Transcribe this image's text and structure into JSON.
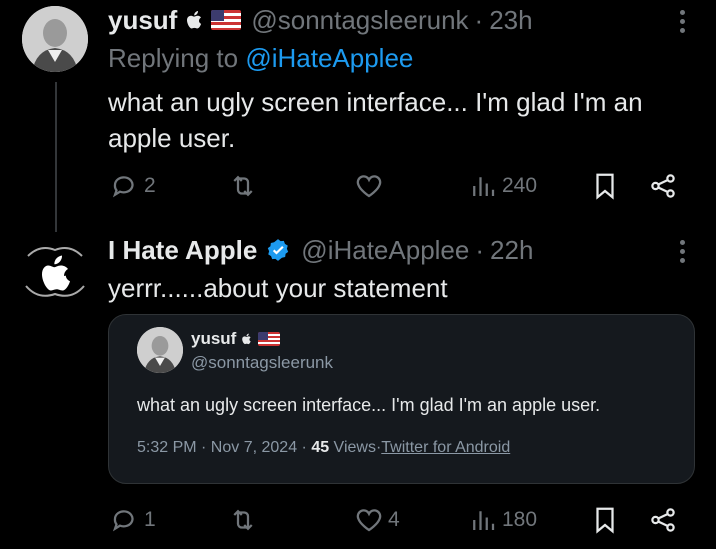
{
  "post1": {
    "display_name": "yusuf",
    "handle": "@sonntagsleerunk",
    "separator": "·",
    "time": "23h",
    "replying_prefix": "Replying to",
    "replying_handle": "@iHateApplee",
    "text": "what an ugly screen interface... I'm glad I'm an apple user.",
    "stats": {
      "replies": "2",
      "reposts": "",
      "likes": "",
      "views": "240"
    }
  },
  "post2": {
    "display_name": "I Hate Apple",
    "handle": "@iHateApplee",
    "separator": "·",
    "time": "22h",
    "text": "yerrr......about your statement",
    "stats": {
      "replies": "1",
      "reposts": "",
      "likes": "4",
      "views": "180"
    }
  },
  "quote": {
    "display_name": "yusuf",
    "handle": "@sonntagsleerunk",
    "text": "what an ugly screen interface... I'm glad I'm an apple user.",
    "time": "5:32 PM · Nov 7, 2024 · ",
    "views_count": "45",
    "views_label": " Views·",
    "source": "Twitter for Android"
  },
  "icons": {
    "reply": "reply-bubble-icon",
    "repost": "repost-icon",
    "like": "heart-icon",
    "views": "views-bar-icon",
    "bookmark": "bookmark-icon",
    "share": "share-icon",
    "verified": "verified-badge-icon",
    "more": "more-options-icon"
  },
  "colors": {
    "background": "#000000",
    "accent": "#1d9bf0",
    "muted": "#71767b",
    "text": "#e7e9ea"
  }
}
